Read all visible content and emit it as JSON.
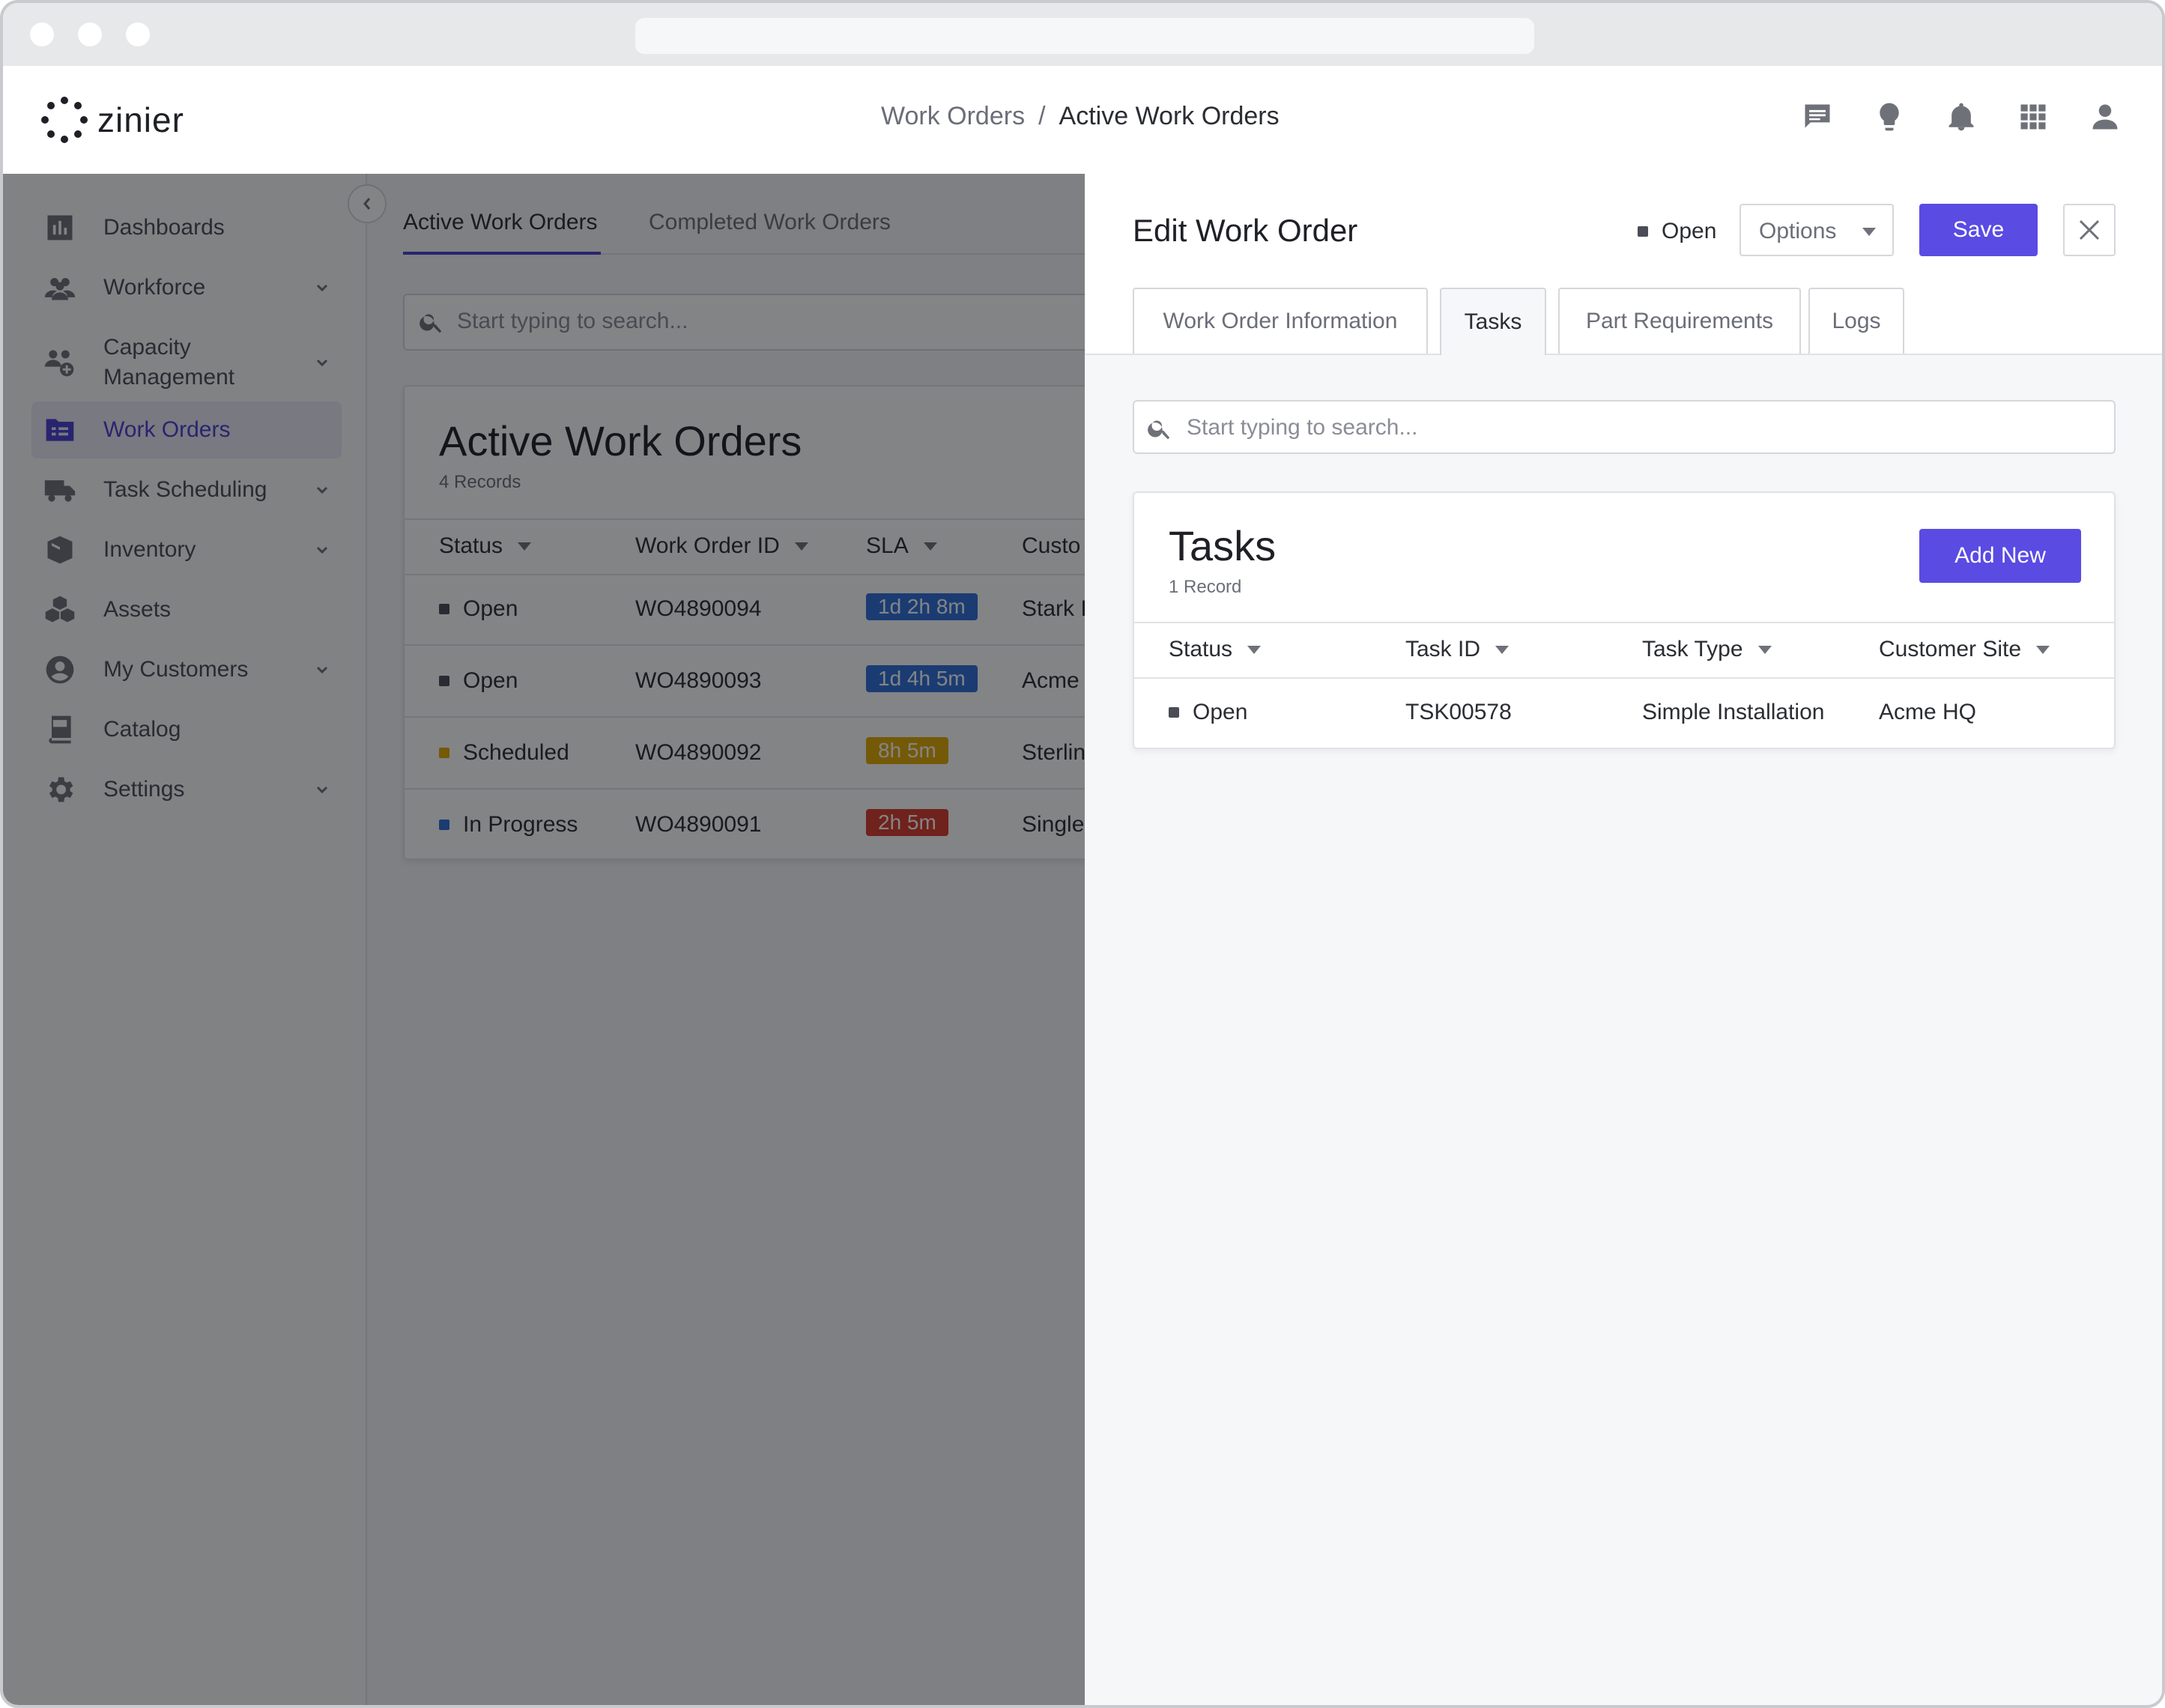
{
  "app": {
    "logo_text": "zinier"
  },
  "breadcrumb": {
    "parent": "Work Orders",
    "separator": "/",
    "current": "Active Work Orders"
  },
  "header_icons": [
    "chat-icon",
    "lightbulb-icon",
    "bell-icon",
    "apps-grid-icon",
    "user-icon"
  ],
  "sidebar": {
    "items": [
      {
        "label": "Dashboards",
        "icon": "chart-icon",
        "expandable": false,
        "active": false
      },
      {
        "label": "Workforce",
        "icon": "people-icon",
        "expandable": true,
        "active": false
      },
      {
        "label_line1": "Capacity",
        "label_line2": "Management",
        "icon": "capacity-icon",
        "expandable": true,
        "active": false
      },
      {
        "label": "Work Orders",
        "icon": "folder-icon",
        "expandable": false,
        "active": true
      },
      {
        "label": "Task Scheduling",
        "icon": "truck-icon",
        "expandable": true,
        "active": false
      },
      {
        "label": "Inventory",
        "icon": "box-icon",
        "expandable": true,
        "active": false
      },
      {
        "label": "Assets",
        "icon": "cubes-icon",
        "expandable": false,
        "active": false
      },
      {
        "label": "My Customers",
        "icon": "account-icon",
        "expandable": true,
        "active": false
      },
      {
        "label": "Catalog",
        "icon": "book-icon",
        "expandable": false,
        "active": false
      },
      {
        "label": "Settings",
        "icon": "gear-icon",
        "expandable": true,
        "active": false
      }
    ]
  },
  "main": {
    "tabs": [
      {
        "label": "Active Work Orders",
        "active": true
      },
      {
        "label": "Completed Work Orders",
        "active": false
      }
    ],
    "search_placeholder": "Start typing to search...",
    "card": {
      "title": "Active Work Orders",
      "subtitle": "4 Records",
      "columns": [
        "Status",
        "Work Order ID",
        "SLA",
        "Custo"
      ],
      "rows": [
        {
          "status": "Open",
          "status_color": "#4a4d56",
          "id": "WO4890094",
          "sla": "1d 2h 8m",
          "sla_color": "#2f6fd6",
          "customer": "Stark I"
        },
        {
          "status": "Open",
          "status_color": "#4a4d56",
          "id": "WO4890093",
          "sla": "1d 4h 5m",
          "sla_color": "#2f6fd6",
          "customer": "Acme C"
        },
        {
          "status": "Scheduled",
          "status_color": "#e0a800",
          "id": "WO4890092",
          "sla": "8h 5m",
          "sla_color": "#e0a800",
          "customer": "Sterlin"
        },
        {
          "status": "In Progress",
          "status_color": "#2f6fd6",
          "id": "WO4890091",
          "sla": "2h 5m",
          "sla_color": "#d93a2b",
          "customer": "Singlet"
        }
      ]
    }
  },
  "panel": {
    "title": "Edit Work Order",
    "status": "Open",
    "status_color": "#4a4d56",
    "options_label": "Options",
    "save_label": "Save",
    "tabs": [
      {
        "label": "Work Order Information",
        "active": false
      },
      {
        "label": "Tasks",
        "active": true
      },
      {
        "label": "Part Requirements",
        "active": false
      },
      {
        "label": "Logs",
        "active": false
      }
    ],
    "search_placeholder": "Start typing to search...",
    "tasks": {
      "title": "Tasks",
      "subtitle": "1 Record",
      "add_label": "Add New",
      "columns": [
        "Status",
        "Task ID",
        "Task Type",
        "Customer Site"
      ],
      "rows": [
        {
          "status": "Open",
          "status_color": "#4a4d56",
          "task_id": "TSK00578",
          "task_type": "Simple Installation",
          "site": "Acme HQ"
        }
      ]
    }
  },
  "colors": {
    "accent": "#5a4be3",
    "nav_active": "#4b3fd1"
  }
}
